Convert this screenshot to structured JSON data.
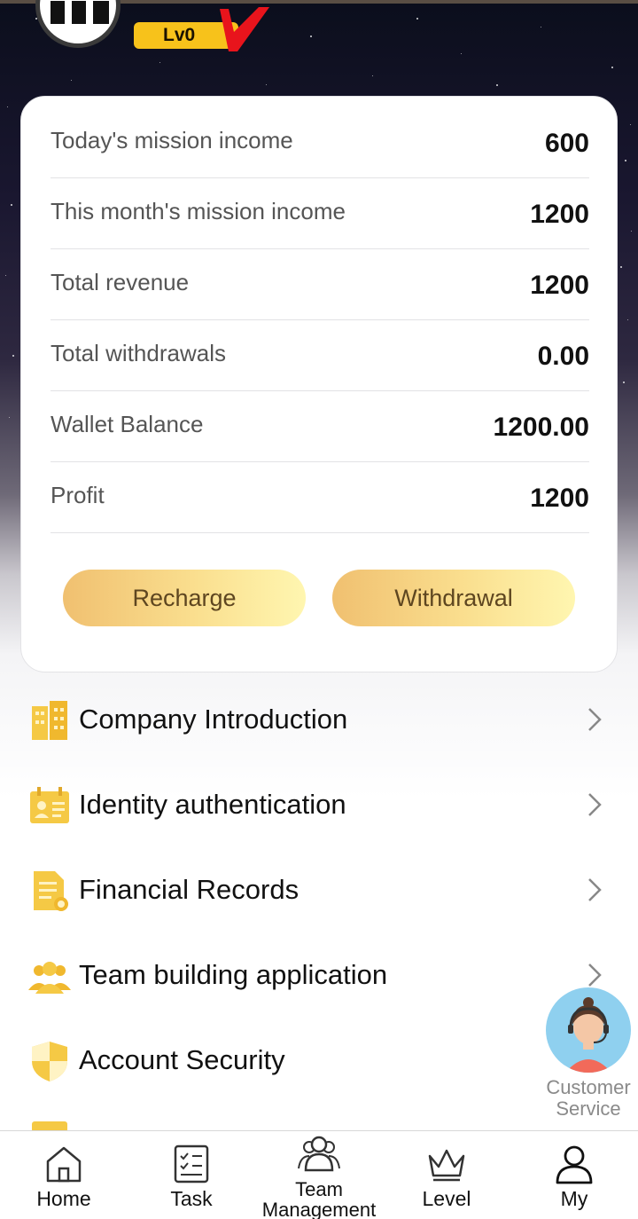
{
  "profile": {
    "level": "Lv0"
  },
  "stats": [
    {
      "label": "Today's mission income",
      "value": "600"
    },
    {
      "label": "This month's mission income",
      "value": "1200"
    },
    {
      "label": "Total revenue",
      "value": "1200"
    },
    {
      "label": "Total withdrawals",
      "value": "0.00"
    },
    {
      "label": "Wallet Balance",
      "value": "1200.00"
    },
    {
      "label": "Profit",
      "value": "1200"
    }
  ],
  "actions": {
    "recharge": "Recharge",
    "withdrawal": "Withdrawal"
  },
  "menu": [
    {
      "label": "Company Introduction",
      "icon": "building-icon"
    },
    {
      "label": "Identity authentication",
      "icon": "id-card-icon"
    },
    {
      "label": "Financial Records",
      "icon": "document-icon"
    },
    {
      "label": "Team building application",
      "icon": "team-icon"
    },
    {
      "label": "Account Security",
      "icon": "shield-icon"
    }
  ],
  "customer_service": {
    "line1": "Customer",
    "line2": "Service"
  },
  "tabs": [
    {
      "label": "Home",
      "icon": "home-icon"
    },
    {
      "label": "Task",
      "icon": "task-icon"
    },
    {
      "label": "Team Management",
      "line1": "Team",
      "line2": "Management",
      "icon": "team-icon"
    },
    {
      "label": "Level",
      "icon": "crown-icon"
    },
    {
      "label": "My",
      "icon": "user-icon"
    }
  ],
  "colors": {
    "accent_gold": "#f7c21b",
    "icon_yellow": "#f5c945",
    "level_v_red": "#e8141c"
  }
}
